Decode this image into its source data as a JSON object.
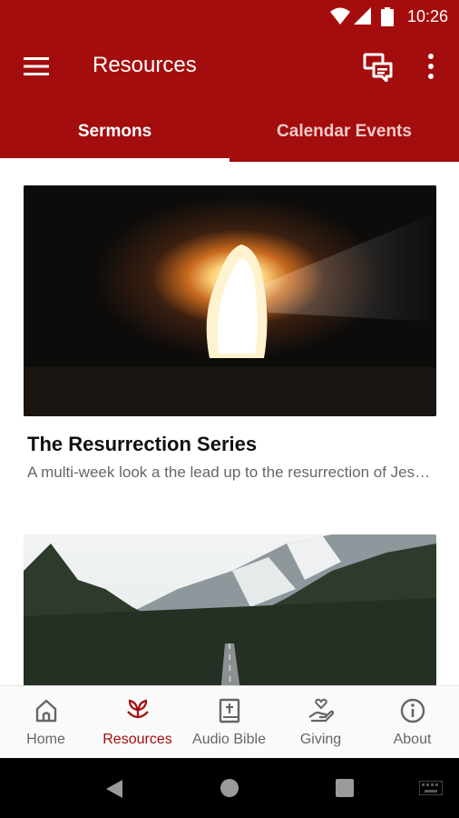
{
  "status_bar": {
    "time": "10:26"
  },
  "app_bar": {
    "title": "Resources"
  },
  "tabs": [
    {
      "label": "Sermons",
      "active": true
    },
    {
      "label": "Calendar Events",
      "active": false
    }
  ],
  "cards": [
    {
      "title": "The Resurrection Series",
      "description": "A multi-week look a the lead up to the resurrection of Jesus"
    },
    {
      "title": "",
      "description": ""
    }
  ],
  "bottom_nav": [
    {
      "label": "Home",
      "icon": "home-icon"
    },
    {
      "label": "Resources",
      "icon": "resources-icon",
      "active": true
    },
    {
      "label": "Audio Bible",
      "icon": "bible-icon"
    },
    {
      "label": "Giving",
      "icon": "giving-icon"
    },
    {
      "label": "About",
      "icon": "info-icon"
    }
  ],
  "colors": {
    "primary": "#a40d0d",
    "active_nav": "#a40d0d",
    "inactive_nav": "#666666"
  }
}
